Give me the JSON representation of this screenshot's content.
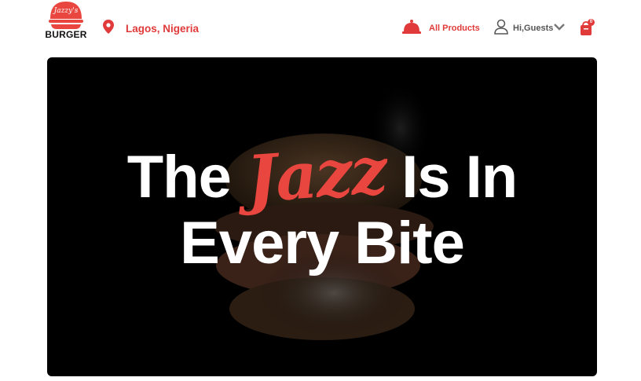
{
  "brand": {
    "script": "Jazzy's",
    "word": "BURGER"
  },
  "header": {
    "location": "Lagos, Nigeria",
    "all_products": "All Products",
    "greeting": "Hi,Guests",
    "cart_count": "0"
  },
  "hero": {
    "line1_a": "The",
    "line1_accent": "Jazz",
    "line1_b": "Is In",
    "line2": "Every Bite"
  },
  "colors": {
    "accent": "#e03a3a",
    "hero_bg": "#000000"
  },
  "icons": [
    "location-pin-icon",
    "service-bell-icon",
    "user-icon",
    "chevron-down-icon",
    "shopping-bag-icon"
  ]
}
